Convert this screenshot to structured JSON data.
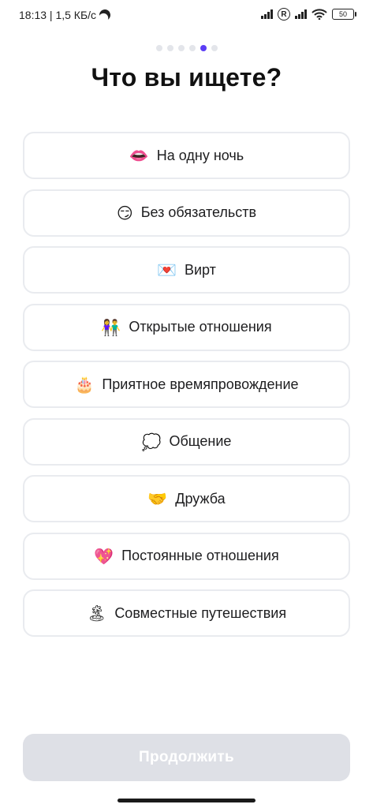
{
  "status_bar": {
    "time_speed": "18:13 | 1,5 КБ/с",
    "roaming_badge": "R",
    "battery": "50"
  },
  "pager": {
    "total": 6,
    "active_index": 4
  },
  "title": "Что вы ищете?",
  "options": [
    {
      "emoji": "👄",
      "label": "На одну ночь"
    },
    {
      "emoji": "😏",
      "label": "Без обязательств"
    },
    {
      "emoji": "💌",
      "label": "Вирт"
    },
    {
      "emoji": "👫",
      "label": "Открытые отношения"
    },
    {
      "emoji": "🎂",
      "label": "Приятное времяпровождение"
    },
    {
      "emoji": "💭",
      "label": "Общение"
    },
    {
      "emoji": "🤝",
      "label": "Дружба"
    },
    {
      "emoji": "💖",
      "label": "Постоянные отношения"
    },
    {
      "emoji": "🏝",
      "label": "Совместные путешествия"
    }
  ],
  "continue_label": "Продолжить"
}
